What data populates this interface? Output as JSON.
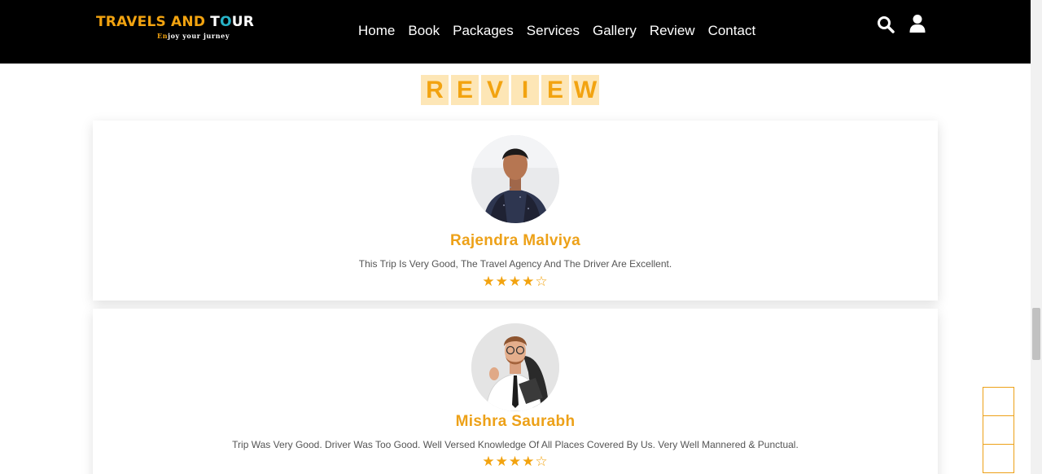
{
  "header": {
    "logo": {
      "title_part1": "TRAVELS AND ",
      "title_part2": "T",
      "title_part3": "O",
      "title_part4": "UR",
      "tagline_part1": "En",
      "tagline_part2": "joy your jurney"
    },
    "nav": [
      "Home",
      "Book",
      "Packages",
      "Services",
      "Gallery",
      "Review",
      "Contact"
    ],
    "icons": [
      "search-icon",
      "user-icon"
    ]
  },
  "review_heading": [
    "R",
    "E",
    "V",
    "I",
    "E",
    "W"
  ],
  "reviews": [
    {
      "name": "Rajendra Malviya",
      "text": "This Trip Is Very Good, The Travel Agency And The Driver Are Excellent.",
      "rating": 4,
      "max_rating": 5,
      "stars": "★★★★☆"
    },
    {
      "name": "Mishra Saurabh",
      "text": "Trip Was Very Good. Driver Was Too Good. Well Versed Knowledge Of All Places Covered By Us. Very Well Mannered & Punctual.",
      "rating": 4,
      "max_rating": 5,
      "stars": "★★★★☆"
    }
  ],
  "colors": {
    "accent": "#eda118",
    "header_bg": "#000000",
    "heading_tile": "#fde6b6",
    "logo_blue": "#27b3c8"
  }
}
